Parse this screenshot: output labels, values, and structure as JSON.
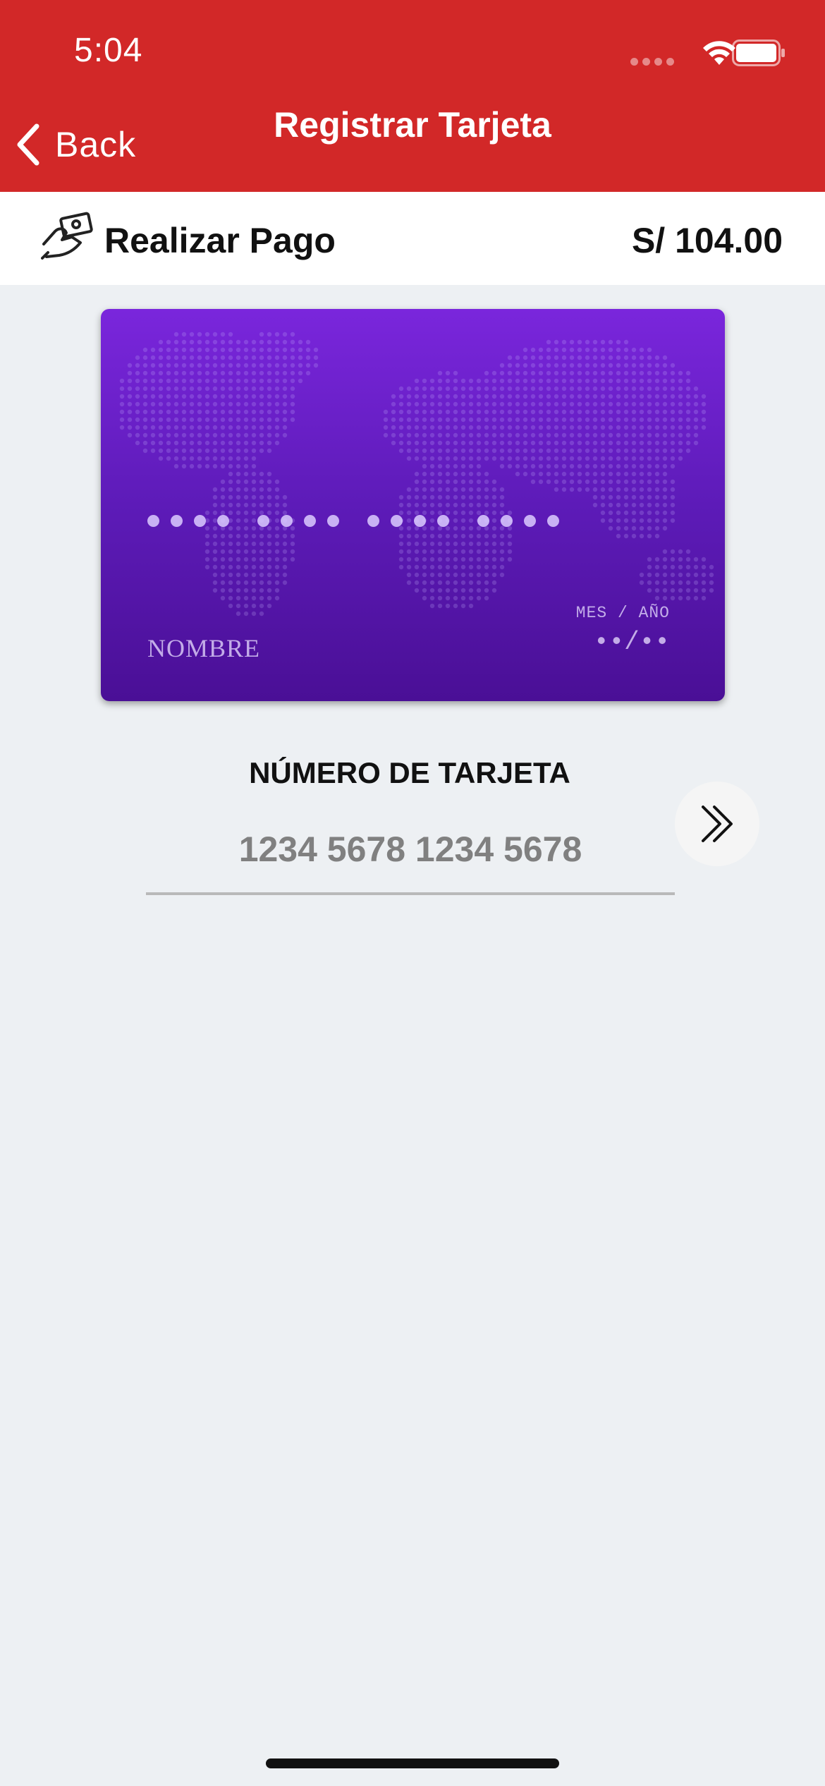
{
  "status_bar": {
    "time": "5:04"
  },
  "nav": {
    "back_label": "Back",
    "title": "Registrar Tarjeta"
  },
  "payment": {
    "label": "Realizar Pago",
    "amount": "S/ 104.00"
  },
  "card": {
    "name_placeholder": "NOMBRE",
    "expiry_label": "MES / AÑO",
    "expiry_value": "••/••"
  },
  "form": {
    "field_label": "NÚMERO DE TARJETA",
    "card_number_value": "",
    "card_number_placeholder": "1234 5678 1234 5678"
  },
  "colors": {
    "header": "#d22828",
    "card_top": "#7a26dc",
    "card_bottom": "#4a0f96",
    "background": "#edf0f3"
  }
}
